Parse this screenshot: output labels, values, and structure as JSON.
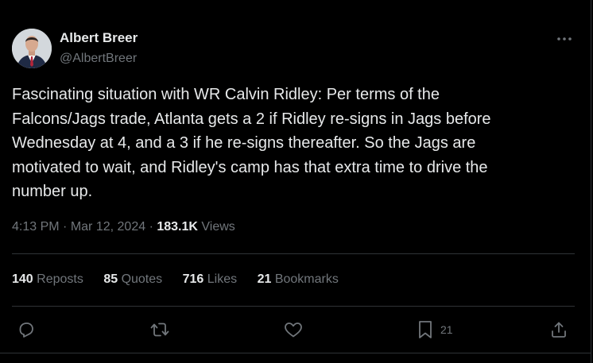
{
  "author": {
    "display_name": "Albert Breer",
    "handle": "@AlbertBreer",
    "avatar": "profile-photo"
  },
  "tweet": {
    "text": "Fascinating situation with WR Calvin Ridley: Per terms of the\nFalcons/Jags trade, Atlanta gets a 2 if Ridley re-signs in Jags before\nWednesday at 4, and a 3 if he re-signs thereafter. So the Jags are\nmotivated to wait, and Ridley's camp has that extra time to drive the\nnumber up.",
    "time": "4:13 PM",
    "date": "Mar 12, 2024",
    "separator": "·",
    "views_count": "183.1K",
    "views_label": "Views"
  },
  "stats": {
    "reposts": {
      "count": "140",
      "label": "Reposts"
    },
    "quotes": {
      "count": "85",
      "label": "Quotes"
    },
    "likes": {
      "count": "716",
      "label": "Likes"
    },
    "bookmarks": {
      "count": "21",
      "label": "Bookmarks"
    }
  },
  "actions": {
    "reply_icon": "reply-icon",
    "repost_icon": "repost-icon",
    "like_icon": "like-icon",
    "bookmark_icon": "bookmark-icon",
    "bookmark_count": "21",
    "share_icon": "share-icon",
    "more_icon": "more-icon"
  },
  "colors": {
    "background": "#000000",
    "text_primary": "#e7e9ea",
    "text_secondary": "#71767b",
    "divider": "#2f3336"
  }
}
